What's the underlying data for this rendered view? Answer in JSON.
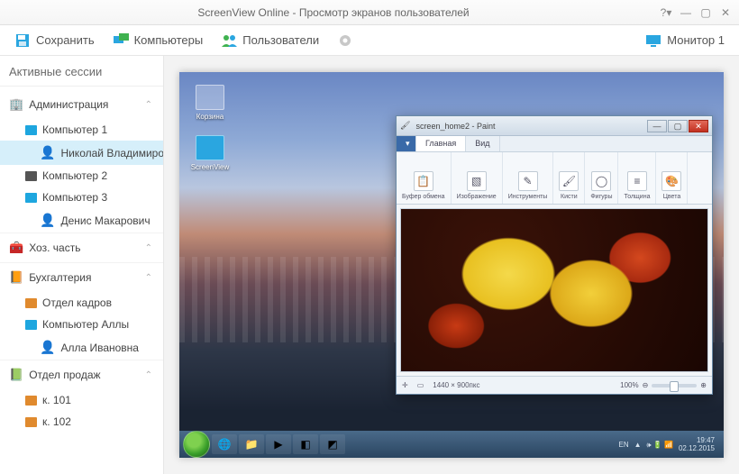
{
  "title": "ScreenView Online - Просмотр экранов пользователей",
  "help": "?",
  "toolbar": {
    "save": "Сохранить",
    "computers": "Компьютеры",
    "users": "Пользователи",
    "monitor": "Монитор 1"
  },
  "sidebar": {
    "header": "Активные сессии",
    "groups": [
      {
        "name": "Администрация",
        "icon": "🏢",
        "items": [
          {
            "type": "comp",
            "label": "Компьютер 1",
            "state": "blue"
          },
          {
            "type": "user",
            "label": "Николай Владимиро...",
            "selected": true
          },
          {
            "type": "comp",
            "label": "Компьютер 2",
            "state": "dark"
          },
          {
            "type": "comp",
            "label": "Компьютер 3",
            "state": "blue"
          },
          {
            "type": "user",
            "label": "Денис Макарович"
          }
        ]
      },
      {
        "name": "Хоз. часть",
        "icon": "🧰",
        "items": []
      },
      {
        "name": "Бухгалтерия",
        "icon": "📙",
        "items": [
          {
            "type": "comp",
            "label": "Отдел кадров",
            "state": "orange"
          },
          {
            "type": "comp",
            "label": "Компьютер Аллы",
            "state": "blue"
          },
          {
            "type": "user",
            "label": "Алла Ивановна"
          }
        ]
      },
      {
        "name": "Отдел продаж",
        "icon": "📗",
        "items": [
          {
            "type": "comp",
            "label": "к. 101",
            "state": "orange"
          },
          {
            "type": "comp",
            "label": "к. 102",
            "state": "orange"
          }
        ]
      }
    ]
  },
  "desktop": {
    "icons": [
      "Корзина",
      "ScreenView"
    ],
    "taskbar_lang": "EN",
    "time": "19:47",
    "date": "02.12.2015"
  },
  "paint": {
    "title": "screen_home2 - Paint",
    "tabs": {
      "main": "Главная",
      "view": "Вид"
    },
    "ribbon": [
      "Буфер обмена",
      "Изображение",
      "Инструменты",
      "Кисти",
      "Фигуры",
      "Толщина",
      "Цвета"
    ],
    "status_dims": "1440 × 900пкс",
    "zoom": "100%"
  }
}
